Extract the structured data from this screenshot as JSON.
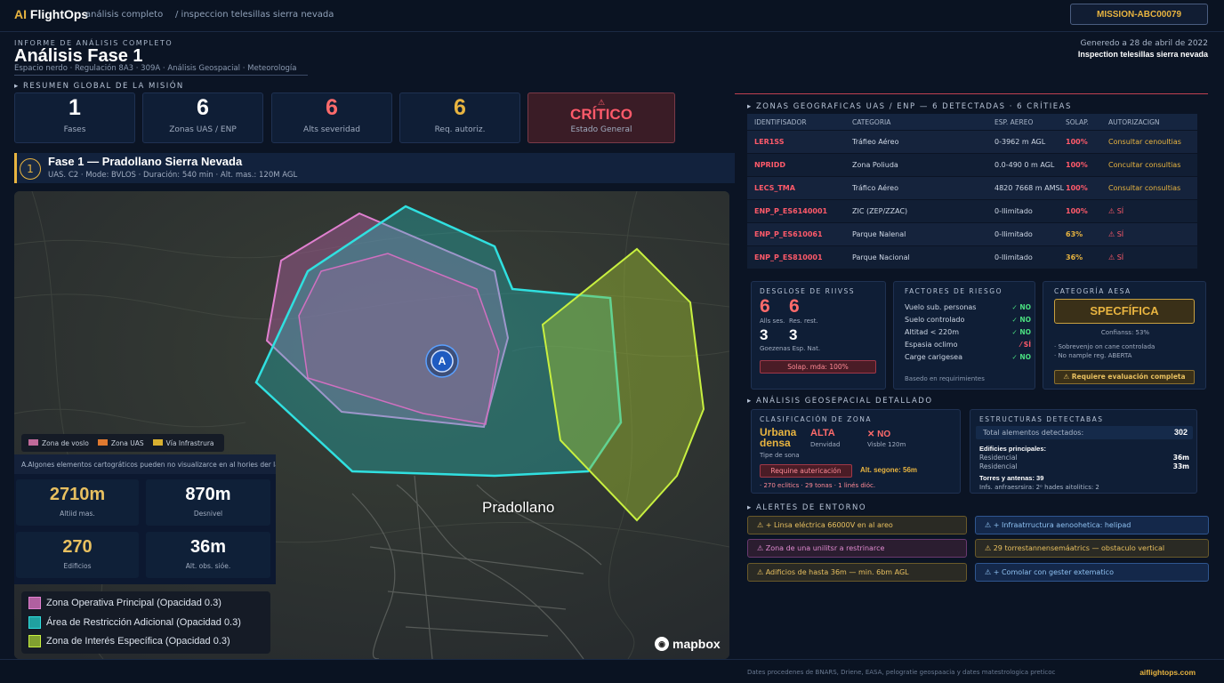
{
  "header": {
    "logo_ai": "AI",
    "logo_text": "FlightOps",
    "subtitle": "análisis completo",
    "breadcrumb": "/ inspeccion telesillas sierra nevada",
    "mission_id": "MISSION-ABC00079"
  },
  "report": {
    "kicker": "INFORME DE ANÁLISIS COMPLETO",
    "title": "Análisis Fase 1",
    "subtitle": "Espacio nerdo · Regulación 8A3 · 309A · Análisis Geospacial · Meteorología",
    "generated": "Generedo a 28 de abril de 2022",
    "project": "Inspection telesillas sierra nevada"
  },
  "summary": {
    "title": "▸ RESUMEN GLOBAL DE LA MISIÓN",
    "kpis": [
      {
        "value": "1",
        "label": "Fases",
        "color": "#ffffff"
      },
      {
        "value": "6",
        "label": "Zonas UAS / ENP",
        "color": "#ffffff"
      },
      {
        "value": "6",
        "label": "Alts severidad",
        "color": "#ff6b6b"
      },
      {
        "value": "6",
        "label": "Req. autoriz.",
        "color": "#e8b440"
      }
    ],
    "status": {
      "icon": "⚠",
      "value": "CRÍTICO",
      "label": "Estado General"
    }
  },
  "phase": {
    "number": "1",
    "title": "Fase 1 — Pradollano Sierra Nevada",
    "meta": "UAS. C2 · Mode: BVLOS · Duración: 540 min · Alt. mas.: 120M AGL"
  },
  "map": {
    "marker": "A",
    "town": "Pradollano",
    "brand": "mapbox",
    "legend_top": [
      {
        "label": "Zona de voslo",
        "color": "#c06a9a"
      },
      {
        "label": "Zona UAS",
        "color": "#e07a30"
      },
      {
        "label": "Vía Infrastrura",
        "color": "#d8b030"
      }
    ],
    "warning": "A.Algones elementos cartográticos pueden no visualizarce en al hories der larcs...",
    "stats": [
      {
        "value": "2710m",
        "label": "Altiid mas.",
        "color": "#e8c060"
      },
      {
        "value": "870m",
        "label": "Desnivel",
        "color": "#ffffff"
      },
      {
        "value": "270",
        "label": "Edificios",
        "color": "#e8c060"
      },
      {
        "value": "36m",
        "label": "Alt. obs. sióe.",
        "color": "#ffffff"
      }
    ],
    "legend_bottom": [
      {
        "label": "Zona Operativa Principal (Opacidad 0.3)",
        "color": "#b060a0"
      },
      {
        "label": "Área de Restricción Adicional (Opacidad 0.3)",
        "color": "#20c0c0"
      },
      {
        "label": "Zona de Interés Específica (Opacidad 0.3)",
        "color": "#a0c030"
      }
    ]
  },
  "zones": {
    "title": "▸ ZONAS GEOGRAFICAS UAS / ENP — 6 DETECTADAS · 6 CRÍTIEAS",
    "headers": [
      "IDENTIFISADOR",
      "CATEGORIA",
      "ESP. AEREO",
      "SOLAP.",
      "AUTORIZACIGN"
    ],
    "rows": [
      [
        "LER1SS",
        "Tráfieo Aéreo",
        "0-3962 m AGL",
        "100%",
        "Consultar cenoultias"
      ],
      [
        "NPRIDD",
        "Zona Poliuda",
        "0.0-490 0 m AGL",
        "100%",
        "Concultar consultias"
      ],
      [
        "LECS_TMA",
        "Tráfico Aéreo",
        "4820 7668 m AMSL",
        "100%",
        "Consultar consultias"
      ],
      [
        "ENP_P_ES6140001",
        "ZIC (ZEP/ZZAC)",
        "0-Ilimitado",
        "100%",
        "⚠ SÍ"
      ],
      [
        "ENP_P_ES610061",
        "Parque Nalenal",
        "0-Ilimitado",
        "63%",
        "⚠ SÍ"
      ],
      [
        "ENP_P_ES810001",
        "Parque Nacional",
        "0-Ilimitado",
        "36%",
        "⚠ SÍ"
      ]
    ]
  },
  "risks": {
    "title": "DESGLOSE DE RIIVSS",
    "a": "6",
    "a_label": "Alls ses.",
    "b": "6",
    "b_label": "Res. rest.",
    "c": "3",
    "d": "3",
    "cd_label": "Goezenas Esp. Nat.",
    "badge": "Solap. mda: 100%"
  },
  "factors": {
    "title": "FACTORES DE RIESGO",
    "items": [
      {
        "label": "Vuelo sub. personas",
        "value": "✓ NO",
        "color": "#4ade80"
      },
      {
        "label": "Suelo controlado",
        "value": "✓ NO",
        "color": "#4ade80"
      },
      {
        "label": "Altitad < 220m",
        "value": "✓ NO",
        "color": "#4ade80"
      },
      {
        "label": "Espasia oclimo",
        "value": "⁄ SÍ",
        "color": "#ff5a6a"
      },
      {
        "label": "Carge carigesea",
        "value": "✓ NO",
        "color": "#4ade80"
      }
    ],
    "note": "Basedo en requirimientes"
  },
  "aesa": {
    "title": "CATEOGRÍA AESA",
    "value": "SPECFÍFICA",
    "conf": "Confianss: 53%",
    "lines": [
      "· Sobrevenjo on cane controlada",
      "· No nample reg. ABERTA"
    ],
    "btn": "⚠ Requiere evaluación completa"
  },
  "geo": {
    "title": "▸ ANÁLISIS GEOSEPACIAL DETALLADO",
    "class_title": "CLASIFICACIÓN DE ZONA",
    "zone_type": "Urbana densa",
    "zone_type_label": "Tipe de sona",
    "density": "ALTA",
    "density_label": "Denvidad",
    "visible": "✕ NO",
    "visible_label": "Visble 120m",
    "auth_btn": "Requine autericación",
    "alt_safe": "Alt. segone: 56m",
    "footnote": "· 270 eclitics · 29 tonas · 1 linés dióc.",
    "struct_title": "ESTRUCTURAS DETECTABAS",
    "total_label": "Total alementos detectados:",
    "total": "302",
    "main_title": "Edificies principales:",
    "main": [
      {
        "label": "Residencial",
        "value": "36m"
      },
      {
        "label": "Residencial",
        "value": "33m"
      }
    ],
    "towers": "Torres y antenas: 39",
    "infra": "Infs. anfraesrsira: 2ᵒ hades aitolitics: 2"
  },
  "alerts": {
    "title": "▸ ALERTES DE ENTORNO",
    "items": [
      {
        "text": "⚠ + Linsa eléctrica 66000V en al areo",
        "style": "a-y"
      },
      {
        "text": "⚠ + Infraatrructura aenoohetica: helipad",
        "style": "a-b"
      },
      {
        "text": "⚠ Zona de una unilitsr a restrinarce",
        "style": "a-m"
      },
      {
        "text": "⚠ 29 torrestannensemáatrics — obstaculo vertical",
        "style": "a-y"
      },
      {
        "text": "⚠ Adificios de hasta 36m — min. 6bm AGL",
        "style": "a-y"
      },
      {
        "text": "⚠ + Comolar con gester extematico",
        "style": "a-b"
      }
    ]
  },
  "footer": {
    "source": "Dates procedenes de BNARS, Driene, EASA, pelogratie geospaacia y dates matestrologica preticoc",
    "brand": "aiflightops.com"
  }
}
